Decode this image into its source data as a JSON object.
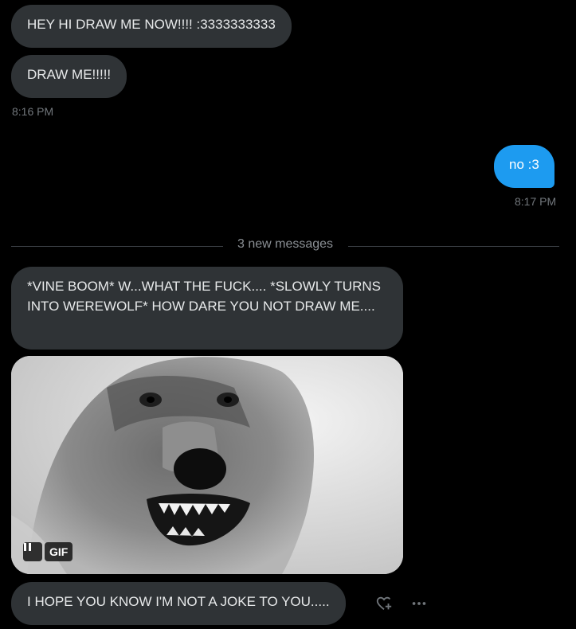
{
  "messages": {
    "m1": "HEY HI DRAW ME NOW!!!! :3333333333",
    "m2": "DRAW ME!!!!!",
    "t1": "8:16 PM",
    "m3": "no :3",
    "t2": "8:17 PM",
    "divider": "3 new messages",
    "m4": "*VINE BOOM* W...WHAT THE FUCK.... *SLOWLY TURNS INTO WEREWOLF* HOW DARE YOU NOT DRAW ME....",
    "m5": "I HOPE YOU KNOW I'M NOT A JOKE TO YOU....."
  },
  "gif": {
    "badge": "GIF",
    "pause_icon": "pause-icon",
    "subject": "snarling wolf"
  },
  "actions": {
    "react_icon": "heart-plus-icon",
    "more_icon": "more-horizontal-icon"
  },
  "colors": {
    "background": "#000000",
    "incoming_bubble": "#2f3336",
    "outgoing_bubble": "#1d9bf0",
    "timestamp": "#71767b"
  }
}
